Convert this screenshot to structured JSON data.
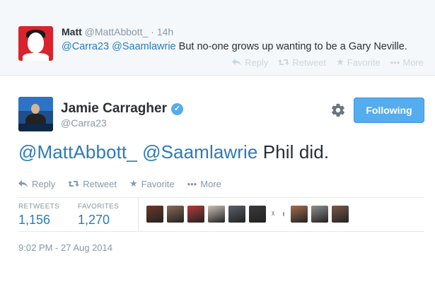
{
  "reply": {
    "name": "Matt",
    "handle": "@MattAbbott_",
    "time": "· 14h",
    "mention1": "@Carra23",
    "mention2": "@Saamlawrie",
    "text": " But no-one grows up wanting to be a Gary Neville.",
    "actions": {
      "reply": "Reply",
      "retweet": "Retweet",
      "favorite": "Favorite",
      "more": "More"
    }
  },
  "tweet": {
    "name": "Jamie Carragher",
    "handle": "@Carra23",
    "mention1": "@MattAbbott_",
    "mention2": "@Saamlawrie",
    "text": "Phil did.",
    "follow_label": "Following",
    "actions": {
      "reply": "Reply",
      "retweet": "Retweet",
      "favorite": "Favorite",
      "more": "More"
    },
    "stats": {
      "retweets_label": "RETWEETS",
      "retweets_value": "1,156",
      "favorites_label": "FAVORITES",
      "favorites_value": "1,270"
    },
    "timestamp": "9:02 PM - 27 Aug 2014"
  },
  "colors": {
    "accent": "#55acee",
    "link": "#2b7bb9",
    "muted": "#8899a6",
    "reply_bg": "#f5f8fa",
    "matt_avatar": "#d9232d"
  },
  "favoriters": [
    {
      "color": "#6b3a2a"
    },
    {
      "color": "#8a6a55"
    },
    {
      "color": "#b43a3a"
    },
    {
      "color": "#c9c0b5"
    },
    {
      "color": "#5a5f6a"
    },
    {
      "color": "#3a3a3a"
    },
    {
      "small": true,
      "glyph": "ᵡ"
    },
    {
      "small": true,
      "glyph": "ᵻ"
    },
    {
      "color": "#a46d4e"
    },
    {
      "color": "#8f8f8f"
    },
    {
      "color": "#7a5a4a"
    }
  ]
}
